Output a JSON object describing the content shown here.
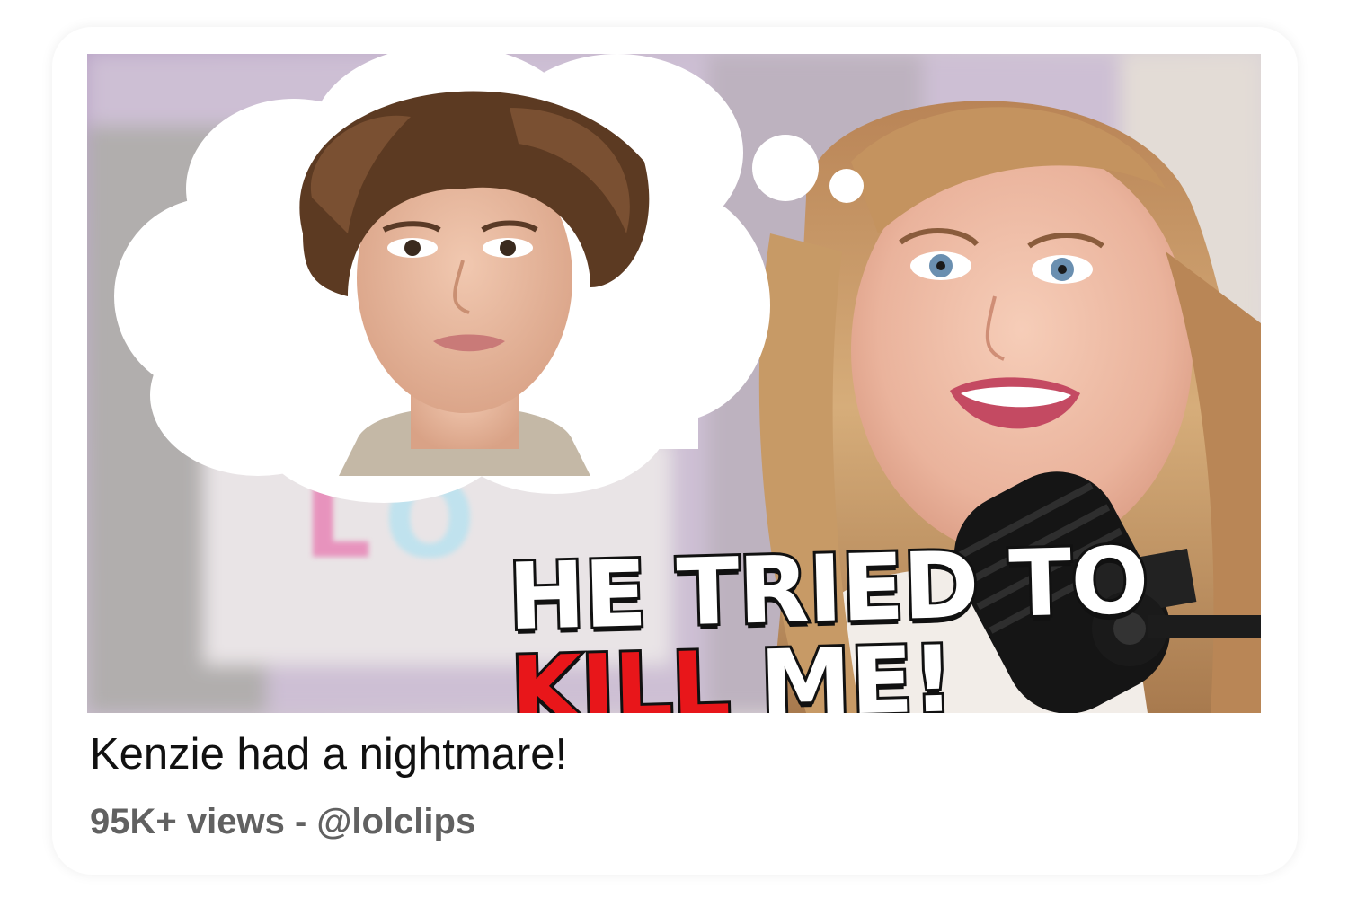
{
  "video": {
    "thumbnail": {
      "headline_line1": "HE TRIED TO",
      "headline_emphasis": "KILL",
      "headline_rest": " ME!",
      "sign_text": "LOL",
      "colors": {
        "headline_fill": "#ffffff",
        "headline_outline": "#111111",
        "emphasis": "#e8161a",
        "background": "#c9bdd0"
      }
    },
    "title": "Kenzie had a nightmare!",
    "views": "95K+ views",
    "separator": " - ",
    "channel": "@lolclips"
  }
}
